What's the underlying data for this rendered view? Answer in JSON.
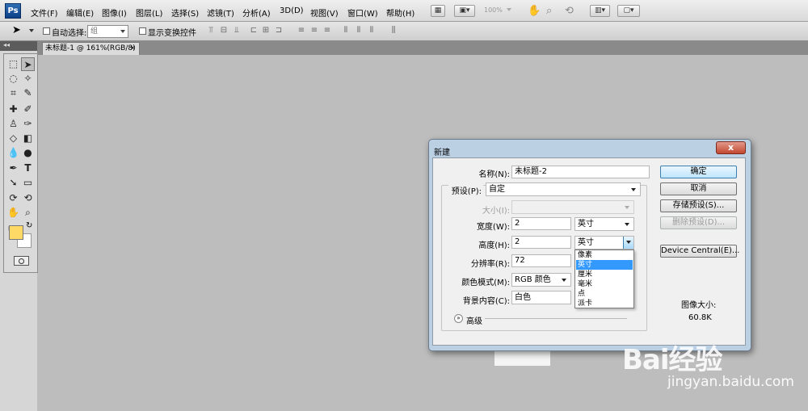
{
  "app": {
    "logo": "Ps"
  },
  "menubar": {
    "items": [
      "文件(F)",
      "编辑(E)",
      "图像(I)",
      "图层(L)",
      "选择(S)",
      "滤镜(T)",
      "分析(A)",
      "3D(D)",
      "视图(V)",
      "窗口(W)",
      "帮助(H)"
    ],
    "zoom": "100%"
  },
  "options": {
    "auto_select_label": "自动选择:",
    "auto_select_value": "组",
    "show_transform_label": "显示变换控件"
  },
  "document": {
    "tab_title": "未标题-1 @ 161%(RGB/8)",
    "tab_close": "×"
  },
  "dialog": {
    "title": "新建",
    "close": "x",
    "name_label": "名称(N):",
    "name_value": "未标题-2",
    "preset_label": "预设(P):",
    "preset_value": "自定",
    "size_label": "大小(I):",
    "width_label": "宽度(W):",
    "width_value": "2",
    "width_unit": "英寸",
    "height_label": "高度(H):",
    "height_value": "2",
    "height_unit": "英寸",
    "resolution_label": "分辨率(R):",
    "resolution_value": "72",
    "color_mode_label": "颜色模式(M):",
    "color_mode_value": "RGB 颜色",
    "bg_label": "背景内容(C):",
    "bg_value": "白色",
    "advanced_label": "高级",
    "ok_button": "确定",
    "cancel_button": "取消",
    "save_preset_button": "存储预设(S)...",
    "delete_preset_button": "删除预设(D)...",
    "device_central_button": "Device Central(E)...",
    "image_size_label": "图像大小:",
    "image_size_value": "60.8K",
    "unit_options": [
      "像素",
      "英寸",
      "厘米",
      "毫米",
      "点",
      "派卡"
    ],
    "unit_selected": "英寸"
  },
  "watermark": {
    "logo": "Bai经验",
    "url": "jingyan.baidu.com"
  },
  "colors": {
    "foreground": "#ffd966",
    "background": "#ffffff",
    "highlight": "#3399ff"
  }
}
